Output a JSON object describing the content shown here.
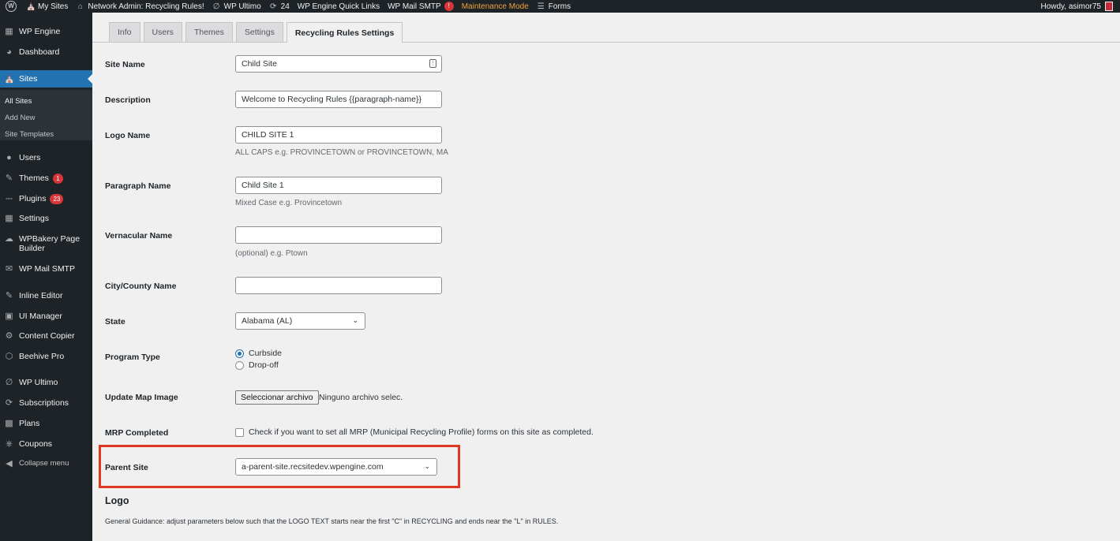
{
  "adminbar": {
    "items": [
      {
        "icon": "wordpress-logo-icon",
        "label": ""
      },
      {
        "icon": "my-sites-icon",
        "label": "My Sites"
      },
      {
        "icon": "home-icon",
        "label": "Network Admin: Recycling Rules!"
      },
      {
        "icon": "wp-ultimo-icon",
        "label": "WP Ultimo"
      },
      {
        "icon": "updates-icon",
        "label": "24"
      },
      {
        "icon": "",
        "label": "WP Engine Quick Links"
      },
      {
        "icon": "",
        "label": "WP Mail SMTP",
        "alert": "!"
      },
      {
        "icon": "",
        "label": "Maintenance Mode"
      },
      {
        "icon": "forms-icon",
        "label": "Forms"
      }
    ],
    "howdy": "Howdy, asimor75"
  },
  "sidebar": {
    "items": [
      {
        "name": "wp-engine",
        "icon": "grid-icon",
        "label": "WP Engine"
      },
      {
        "name": "dashboard",
        "icon": "dashboard-icon",
        "label": "Dashboard"
      },
      {
        "name": "sites",
        "icon": "sites-icon",
        "label": "Sites"
      },
      {
        "name": "users",
        "icon": "users-icon",
        "label": "Users"
      },
      {
        "name": "themes",
        "icon": "themes-icon",
        "label": "Themes",
        "count": "1"
      },
      {
        "name": "plugins",
        "icon": "plugins-icon",
        "label": "Plugins",
        "count": "23"
      },
      {
        "name": "settings",
        "icon": "settings-icon",
        "label": "Settings"
      },
      {
        "name": "wpbakery",
        "icon": "cloud-icon",
        "label": "WPBakery Page",
        "label2": "Builder"
      },
      {
        "name": "wp-mail-smtp",
        "icon": "mail-icon",
        "label": "WP Mail SMTP"
      },
      {
        "name": "inline-editor",
        "icon": "pencil-icon",
        "label": "Inline Editor"
      },
      {
        "name": "ui-manager",
        "icon": "ui-icon",
        "label": "UI Manager"
      },
      {
        "name": "content-copier",
        "icon": "gear-icon",
        "label": "Content Copier"
      },
      {
        "name": "beehive-pro",
        "icon": "beehive-icon",
        "label": "Beehive Pro"
      },
      {
        "name": "wp-ultimo",
        "icon": "wp-ultimo-icon",
        "label": "WP Ultimo"
      },
      {
        "name": "subscriptions",
        "icon": "refresh-icon",
        "label": "Subscriptions"
      },
      {
        "name": "plans",
        "icon": "plans-icon",
        "label": "Plans"
      },
      {
        "name": "coupons",
        "icon": "coupons-icon",
        "label": "Coupons"
      },
      {
        "name": "collapse",
        "icon": "collapse-icon",
        "label": "Collapse menu"
      }
    ],
    "submenu": [
      "All Sites",
      "Add New",
      "Site Templates"
    ]
  },
  "tabs": [
    "Info",
    "Users",
    "Themes",
    "Settings",
    "Recycling Rules Settings"
  ],
  "form": {
    "site_name": {
      "label": "Site Name",
      "value": "Child Site"
    },
    "description": {
      "label": "Description",
      "value": "Welcome to Recycling Rules {{paragraph-name}}"
    },
    "logo_name": {
      "label": "Logo Name",
      "value": "CHILD SITE 1",
      "help": "ALL CAPS e.g. PROVINCETOWN or PROVINCETOWN, MA"
    },
    "paragraph_name": {
      "label": "Paragraph Name",
      "value": "Child Site 1",
      "help": "Mixed Case e.g. Provincetown"
    },
    "vernacular_name": {
      "label": "Vernacular Name",
      "value": "",
      "help": "(optional) e.g. Ptown"
    },
    "city_county": {
      "label": "City/County Name",
      "value": ""
    },
    "state": {
      "label": "State",
      "value": "Alabama (AL)"
    },
    "program_type": {
      "label": "Program Type",
      "options": [
        "Curbside",
        "Drop-off"
      ],
      "selected": "Curbside"
    },
    "map_image": {
      "label": "Update Map Image",
      "button": "Seleccionar archivo",
      "status": "Ninguno archivo selec."
    },
    "mrp": {
      "label": "MRP Completed",
      "text": "Check if you want to set all MRP (Municipal Recycling Profile) forms on this site as completed.",
      "checked": false
    },
    "parent_site": {
      "label": "Parent Site",
      "value": "a-parent-site.recsitedev.wpengine.com"
    }
  },
  "logo_section": {
    "title": "Logo",
    "guidance": "General Guidance: adjust parameters below such that the LOGO TEXT starts near the first \"C\" in RECYCLING and ends near the \"L\" in RULES."
  },
  "colors": {
    "admin_bg": "#1d2327",
    "accent": "#2271b1",
    "highlight": "#e1361f",
    "badge": "#d63638"
  }
}
